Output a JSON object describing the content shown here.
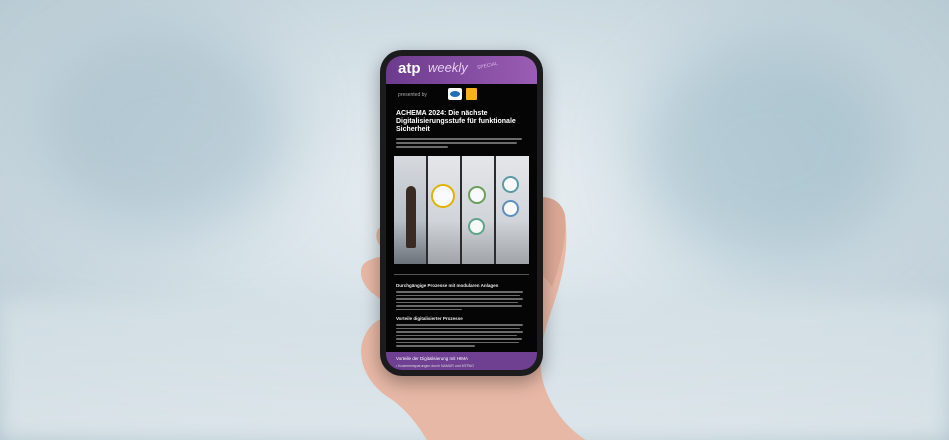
{
  "newsletter": {
    "brand": "atp",
    "brand_suffix": "weekly",
    "badge": "SPECIAL",
    "sponsor_label": "presented by",
    "headline": "ACHEMA 2024: Die nächste Digitalisierungsstufe für funktionale Sicherheit",
    "section1_heading": "Durchgängige Prozesse mit modularen Anlagen",
    "section2_heading": "Vorteile digitalisierter Prozesse",
    "footer_title": "Vorteile der Digitalisierung mit HIMA",
    "footer_line": "• Kosteneinsparungen durch NAMUR und MTPAO"
  },
  "colors": {
    "header_purple": "#7b4a9d",
    "sponsor_blue": "#1d6fb8",
    "sponsor_yellow": "#f5b21a"
  }
}
